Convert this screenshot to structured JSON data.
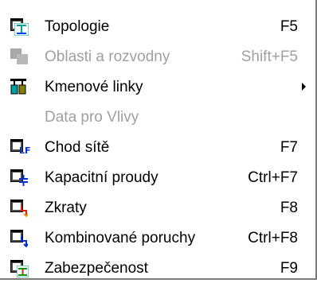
{
  "menu": {
    "items": [
      {
        "label": "Topologie",
        "shortcut": "F5",
        "icon": "topology-icon",
        "enabled": true
      },
      {
        "label": "Oblasti a rozvodny",
        "shortcut": "Shift+F5",
        "icon": "areas-icon",
        "enabled": false
      },
      {
        "label": "Kmenové linky",
        "shortcut": "",
        "icon": "trunk-lines-icon",
        "enabled": true,
        "submenu": true
      },
      {
        "label": "Data pro Vlivy",
        "shortcut": "",
        "icon": "",
        "enabled": false
      },
      {
        "label": "Chod sítě",
        "shortcut": "F7",
        "icon": "load-flow-icon",
        "enabled": true
      },
      {
        "label": "Kapacitní proudy",
        "shortcut": "Ctrl+F7",
        "icon": "capacitive-currents-icon",
        "enabled": true
      },
      {
        "label": "Zkraty",
        "shortcut": "F8",
        "icon": "short-circuit-icon",
        "enabled": true
      },
      {
        "label": "Kombinované poruchy",
        "shortcut": "Ctrl+F8",
        "icon": "combined-faults-icon",
        "enabled": true
      },
      {
        "label": "Zabezpečenost",
        "shortcut": "F9",
        "icon": "reliability-icon",
        "enabled": true
      }
    ],
    "badges": {
      "load_flow": "LF"
    }
  }
}
